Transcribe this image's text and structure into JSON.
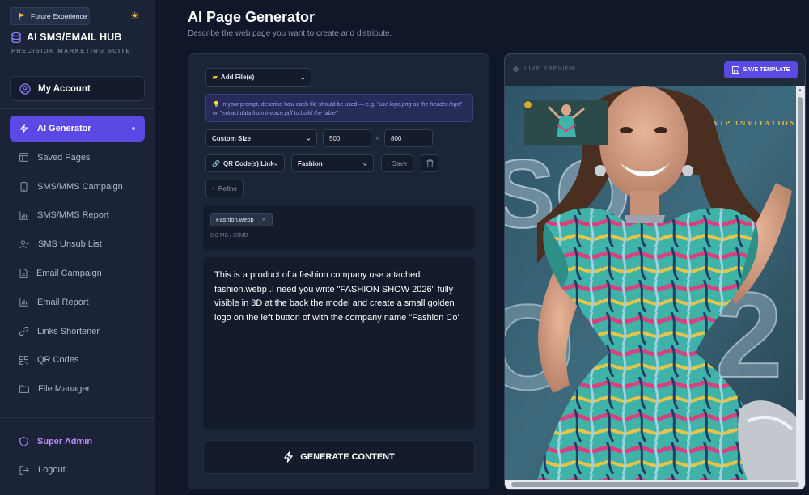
{
  "sidebar": {
    "badge": "Future Experience",
    "app_title": "AI SMS/EMAIL HUB",
    "app_subtitle": "PRECISION MARKETING SUITE",
    "account": "My Account",
    "items": [
      {
        "label": "AI Generator"
      },
      {
        "label": "Saved Pages"
      },
      {
        "label": "SMS/MMS Campaign"
      },
      {
        "label": "SMS/MMS Report"
      },
      {
        "label": "SMS Unsub List"
      },
      {
        "label": "Email Campaign"
      },
      {
        "label": "Email Report"
      },
      {
        "label": "Links Shortener"
      },
      {
        "label": "QR Codes"
      },
      {
        "label": "File Manager"
      }
    ],
    "super_admin": "Super Admin",
    "logout": "Logout"
  },
  "header": {
    "title": "AI Page Generator",
    "description": "Describe the web page you want to create and distribute."
  },
  "form": {
    "add_files": "Add File(s)",
    "hint_prefix": "In your prompt, describe how each file should be used — e.g.",
    "hint_example_1": "\"use logo.png as the header logo\"",
    "hint_or": "or",
    "hint_example_2": "\"extract data from invoice.pdf to build the table\"",
    "size_select": "Custom Size",
    "width": "500",
    "height": "800",
    "size_separator": "×",
    "qr_select": "QR Code(s) Link",
    "template_select": "Fashion",
    "save_label": "Save",
    "refine_label": "Refine",
    "file_name": "Fashion.webp",
    "file_size": "0.0 MB / 20MB",
    "prompt": "This is a product of a fashion company use attached fashion.webp .I need you write \"FASHION SHOW 2026\" fully visible  in 3D at the back  the model and create a small golden logo on the left button of  with the company name \"Fashion Co\"",
    "generate_label": "GENERATE CONTENT"
  },
  "preview": {
    "label": "LIVE PREVIEW",
    "save_template": "SAVE TEMPLATE",
    "vip_text": "VIP INVITATION"
  },
  "colors": {
    "accent": "#5b49e5",
    "background": "#0f1729",
    "sidebar": "#1b2436",
    "gold": "#d8b24a",
    "admin": "#b78cff"
  }
}
